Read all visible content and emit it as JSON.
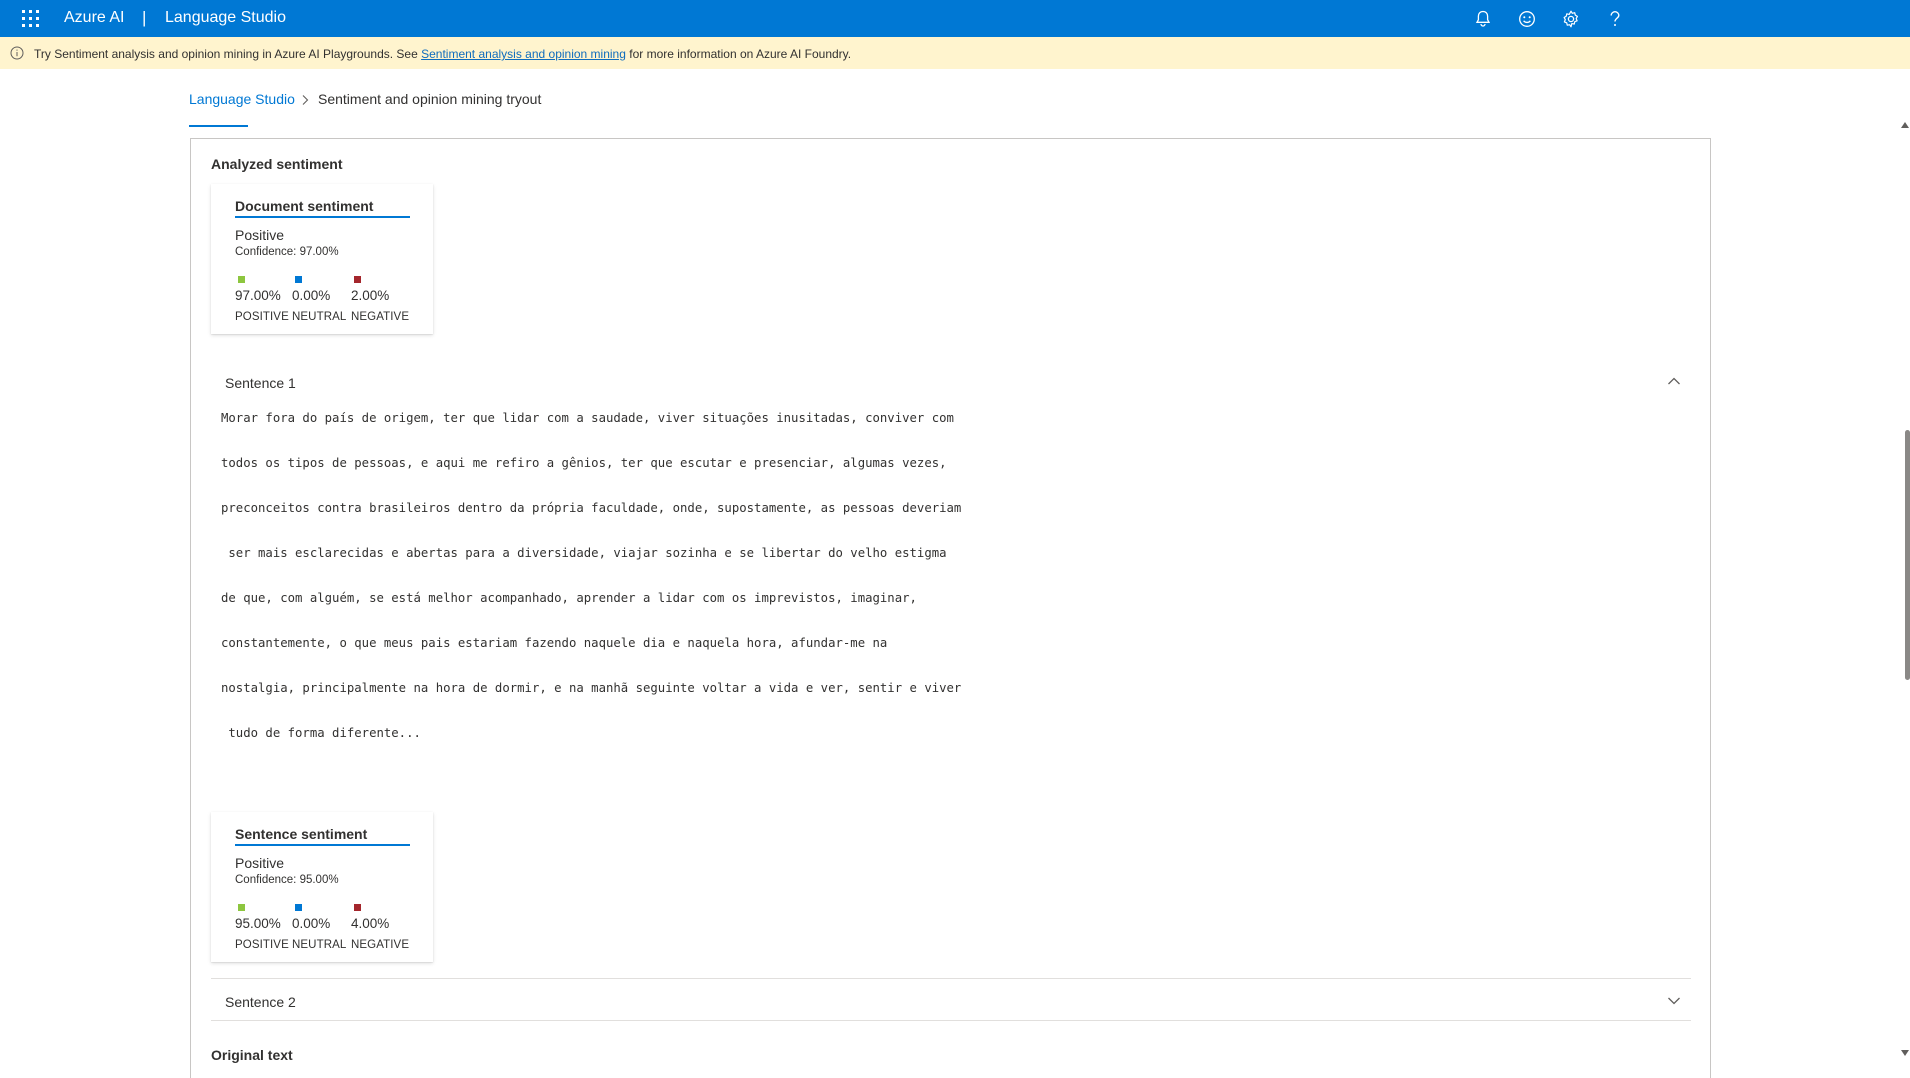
{
  "header": {
    "brand": "Azure AI",
    "separator": "|",
    "product": "Language Studio",
    "icons": [
      "waffle-icon",
      "bell-icon",
      "smiley-icon",
      "gear-icon",
      "help-icon"
    ]
  },
  "banner": {
    "text_before": "Try Sentiment analysis and opinion mining in Azure AI Playgrounds. See ",
    "link": "Sentiment analysis and opinion mining",
    "text_after": " for more information on Azure AI Foundry."
  },
  "breadcrumb": {
    "root": "Language Studio",
    "current": "Sentiment and opinion mining tryout"
  },
  "analyzed": {
    "title": "Analyzed sentiment",
    "document": {
      "title": "Document sentiment",
      "label": "Positive",
      "confidence": "Confidence: 97.00%",
      "positive": "97.00%",
      "neutral": "0.00%",
      "negative": "2.00%",
      "positive_label": "POSITIVE",
      "neutral_label": "NEUTRAL",
      "negative_label": "NEGATIVE"
    },
    "sentence1": {
      "header": "Sentence 1",
      "expanded": true,
      "lines": [
        "Morar fora do país de origem, ter que lidar com a saudade, viver situações inusitadas, conviver com",
        "todos os tipos de pessoas, e aqui me refiro a gênios, ter que escutar e presenciar, algumas vezes,",
        "preconceitos contra brasileiros dentro da própria faculdade, onde, supostamente, as pessoas deveriam",
        " ser mais esclarecidas e abertas para a diversidade, viajar sozinha e se libertar do velho estigma",
        "de que, com alguém, se está melhor acompanhado, aprender a lidar com os imprevistos, imaginar,",
        "constantemente, o que meus pais estariam fazendo naquele dia e naquela hora, afundar-me na",
        "nostalgia, principalmente na hora de dormir, e na manhã seguinte voltar a vida e ver, sentir e viver",
        " tudo de forma diferente..."
      ],
      "sentiment": {
        "title": "Sentence sentiment",
        "label": "Positive",
        "confidence": "Confidence: 95.00%",
        "positive": "95.00%",
        "neutral": "0.00%",
        "negative": "4.00%",
        "positive_label": "POSITIVE",
        "neutral_label": "NEUTRAL",
        "negative_label": "NEGATIVE"
      }
    },
    "sentence2": {
      "header": "Sentence 2",
      "expanded": false
    }
  },
  "original_text_title": "Original text",
  "colors": {
    "accent": "#0078d4",
    "banner_bg": "#fff4ce",
    "positive": "#8dc63f",
    "neutral": "#0078d4",
    "negative": "#a4262c"
  }
}
